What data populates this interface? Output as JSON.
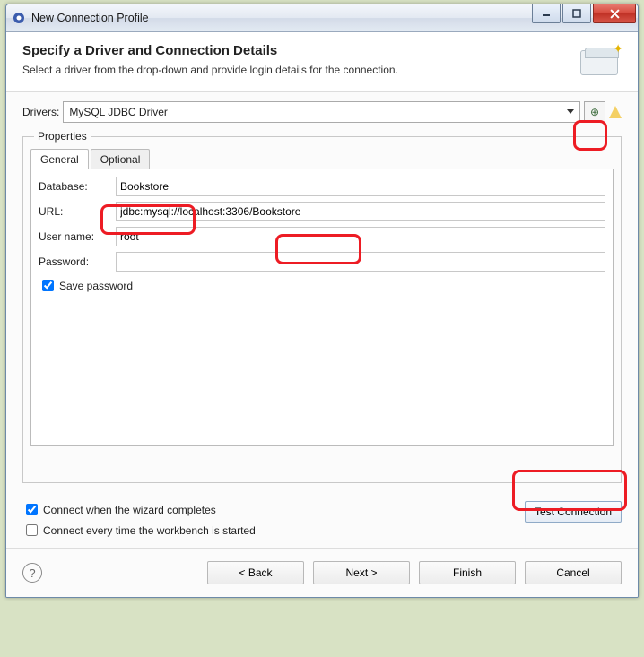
{
  "window": {
    "title": "New Connection Profile"
  },
  "header": {
    "heading": "Specify a Driver and Connection Details",
    "subheading": "Select a driver from the drop-down and provide login details for the connection."
  },
  "drivers": {
    "label": "Drivers:",
    "selected": "MySQL JDBC Driver"
  },
  "properties": {
    "legend": "Properties",
    "tabs": {
      "general": "General",
      "optional": "Optional"
    },
    "fields": {
      "database_label": "Database:",
      "database_value": "Bookstore",
      "url_label": "URL:",
      "url_value": "jdbc:mysql://localhost:3306/Bookstore",
      "username_label": "User name:",
      "username_value": "root",
      "password_label": "Password:",
      "password_value": "",
      "save_password_label": "Save password"
    }
  },
  "options": {
    "connect_on_finish": "Connect when the wizard completes",
    "connect_on_start": "Connect every time the workbench is started",
    "test_connection": "Test Connection"
  },
  "footer": {
    "back": "< Back",
    "next": "Next >",
    "finish": "Finish",
    "cancel": "Cancel"
  }
}
